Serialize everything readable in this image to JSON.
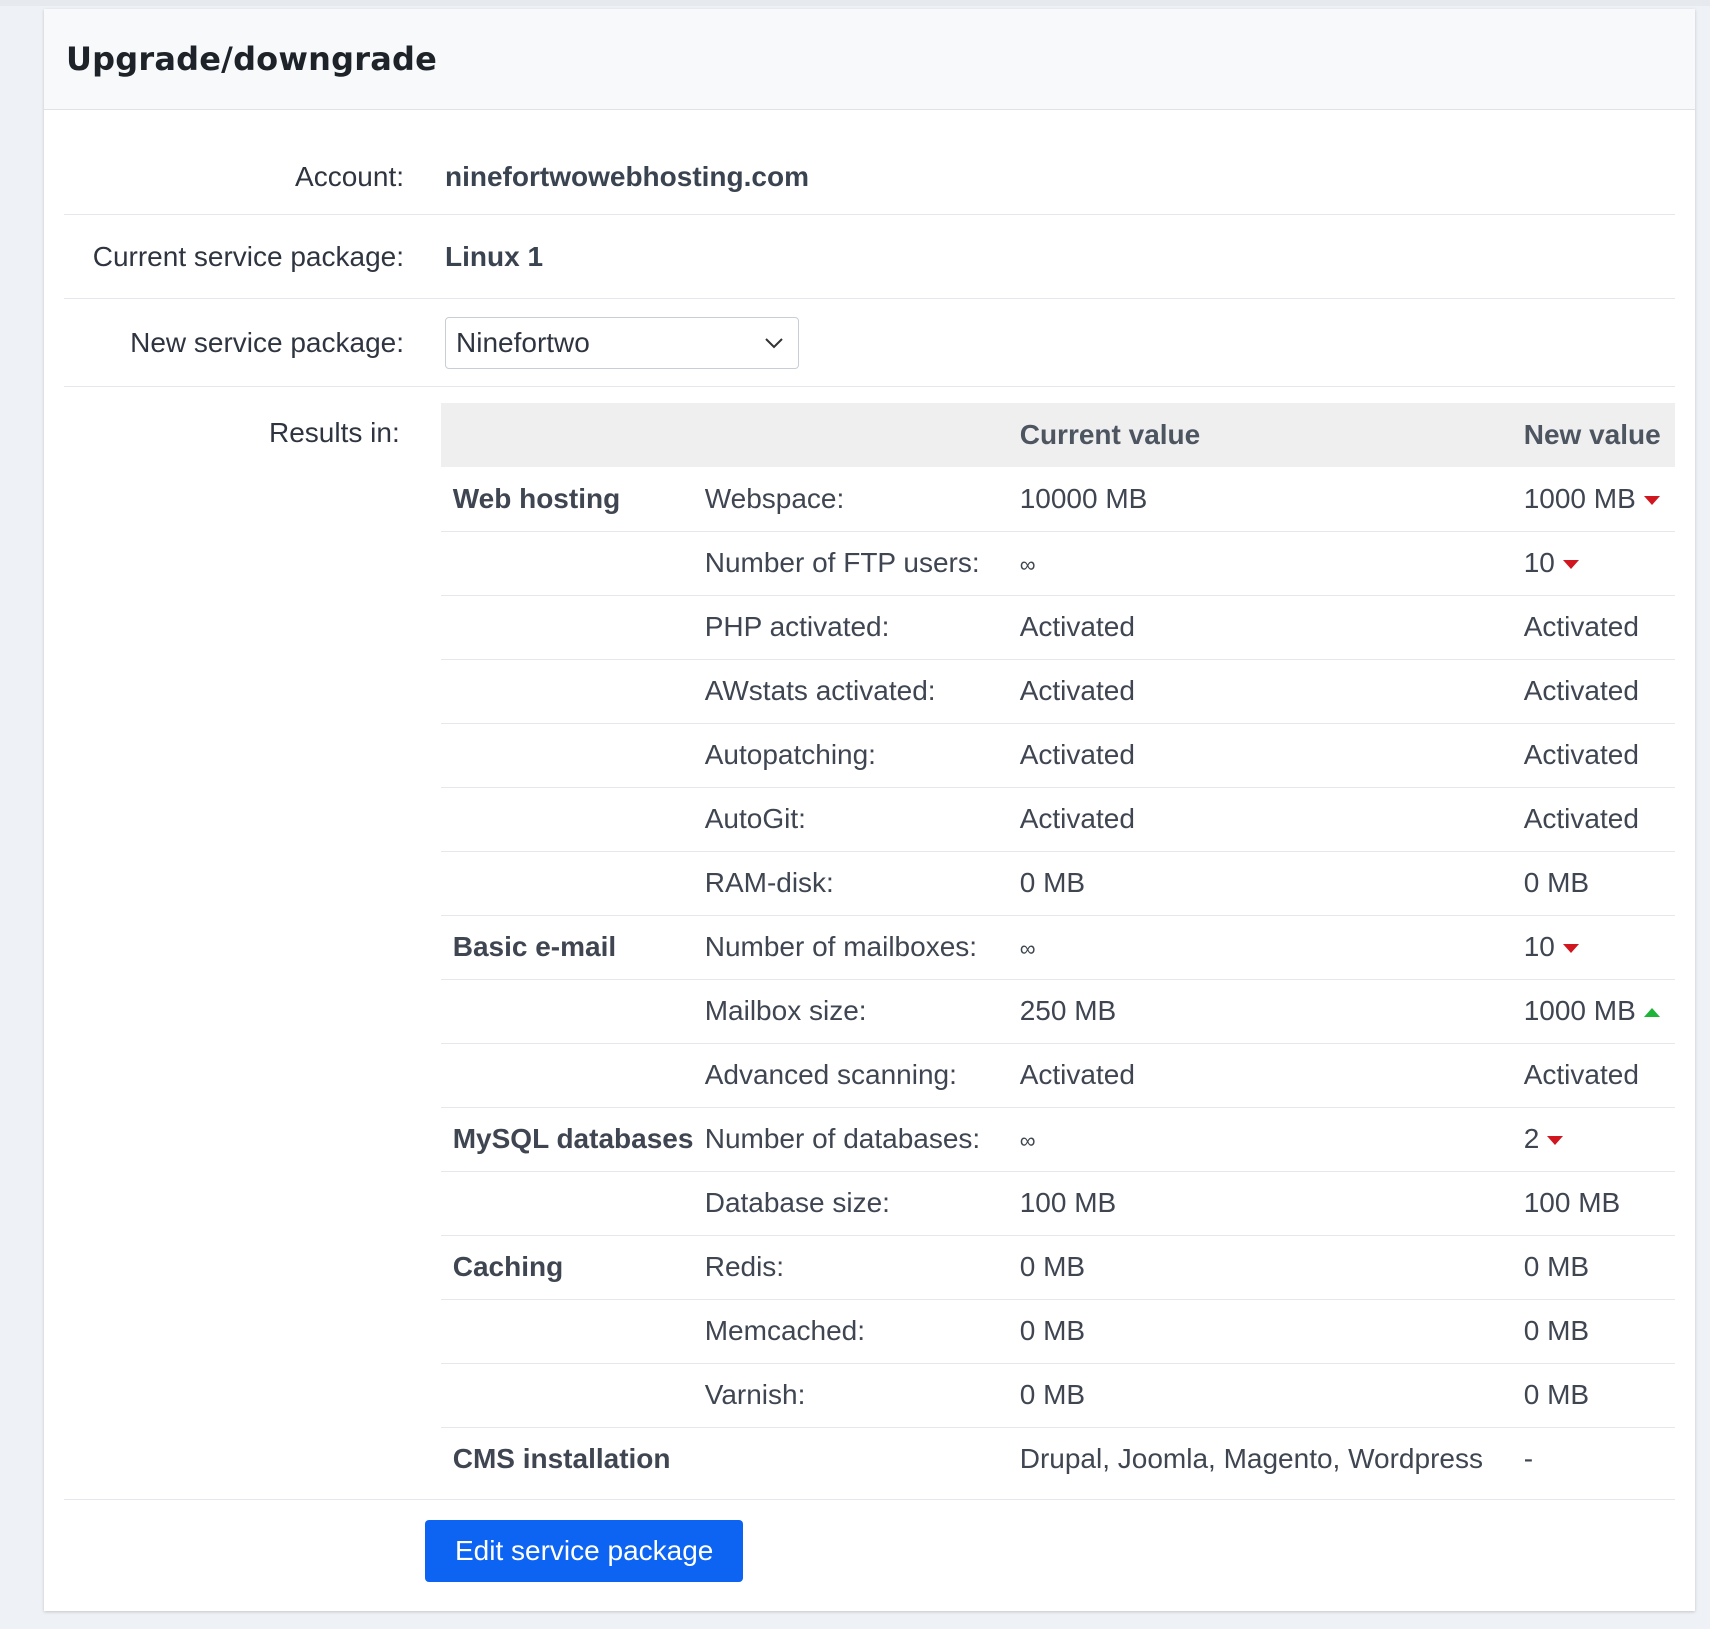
{
  "panel": {
    "title": "Upgrade/downgrade"
  },
  "form": {
    "account_label": "Account:",
    "account_value": "ninefortwowebhosting.com",
    "current_label": "Current service package:",
    "current_value": "Linux 1",
    "new_label": "New service package:",
    "new_value": "Ninefortwo",
    "results_label": "Results in:"
  },
  "results": {
    "headers": {
      "group": "",
      "label": "",
      "current": "Current value",
      "new": "New value"
    },
    "rows": [
      {
        "group": "Web hosting",
        "label": "Webspace:",
        "current": "10000 MB",
        "new": "1000 MB",
        "trend": "down"
      },
      {
        "group": "",
        "label": "Number of FTP users:",
        "current": "∞",
        "new": "10",
        "trend": "down"
      },
      {
        "group": "",
        "label": "PHP activated:",
        "current": "Activated",
        "new": "Activated",
        "trend": ""
      },
      {
        "group": "",
        "label": "AWstats activated:",
        "current": "Activated",
        "new": "Activated",
        "trend": ""
      },
      {
        "group": "",
        "label": "Autopatching:",
        "current": "Activated",
        "new": "Activated",
        "trend": ""
      },
      {
        "group": "",
        "label": "AutoGit:",
        "current": "Activated",
        "new": "Activated",
        "trend": ""
      },
      {
        "group": "",
        "label": "RAM-disk:",
        "current": "0 MB",
        "new": "0 MB",
        "trend": ""
      },
      {
        "group": "Basic e-mail",
        "label": "Number of mailboxes:",
        "current": "∞",
        "new": "10",
        "trend": "down"
      },
      {
        "group": "",
        "label": "Mailbox size:",
        "current": "250 MB",
        "new": "1000 MB",
        "trend": "up"
      },
      {
        "group": "",
        "label": "Advanced scanning:",
        "current": "Activated",
        "new": "Activated",
        "trend": ""
      },
      {
        "group": "MySQL databases",
        "label": "Number of databases:",
        "current": "∞",
        "new": "2",
        "trend": "down"
      },
      {
        "group": "",
        "label": "Database size:",
        "current": "100 MB",
        "new": "100 MB",
        "trend": ""
      },
      {
        "group": "Caching",
        "label": "Redis:",
        "current": "0 MB",
        "new": "0 MB",
        "trend": ""
      },
      {
        "group": "",
        "label": "Memcached:",
        "current": "0 MB",
        "new": "0 MB",
        "trend": ""
      },
      {
        "group": "",
        "label": "Varnish:",
        "current": "0 MB",
        "new": "0 MB",
        "trend": ""
      },
      {
        "group": "CMS installation",
        "label": "",
        "current": "Drupal, Joomla, Magento, Wordpress",
        "new": "-",
        "trend": ""
      }
    ]
  },
  "actions": {
    "edit_label": "Edit service package"
  },
  "colors": {
    "accent": "#0d64f2",
    "down": "#d0161f",
    "up": "#1fb437"
  },
  "icons": {
    "select": "chevron-down-icon",
    "down": "triangle-down-icon",
    "up": "triangle-up-icon"
  }
}
